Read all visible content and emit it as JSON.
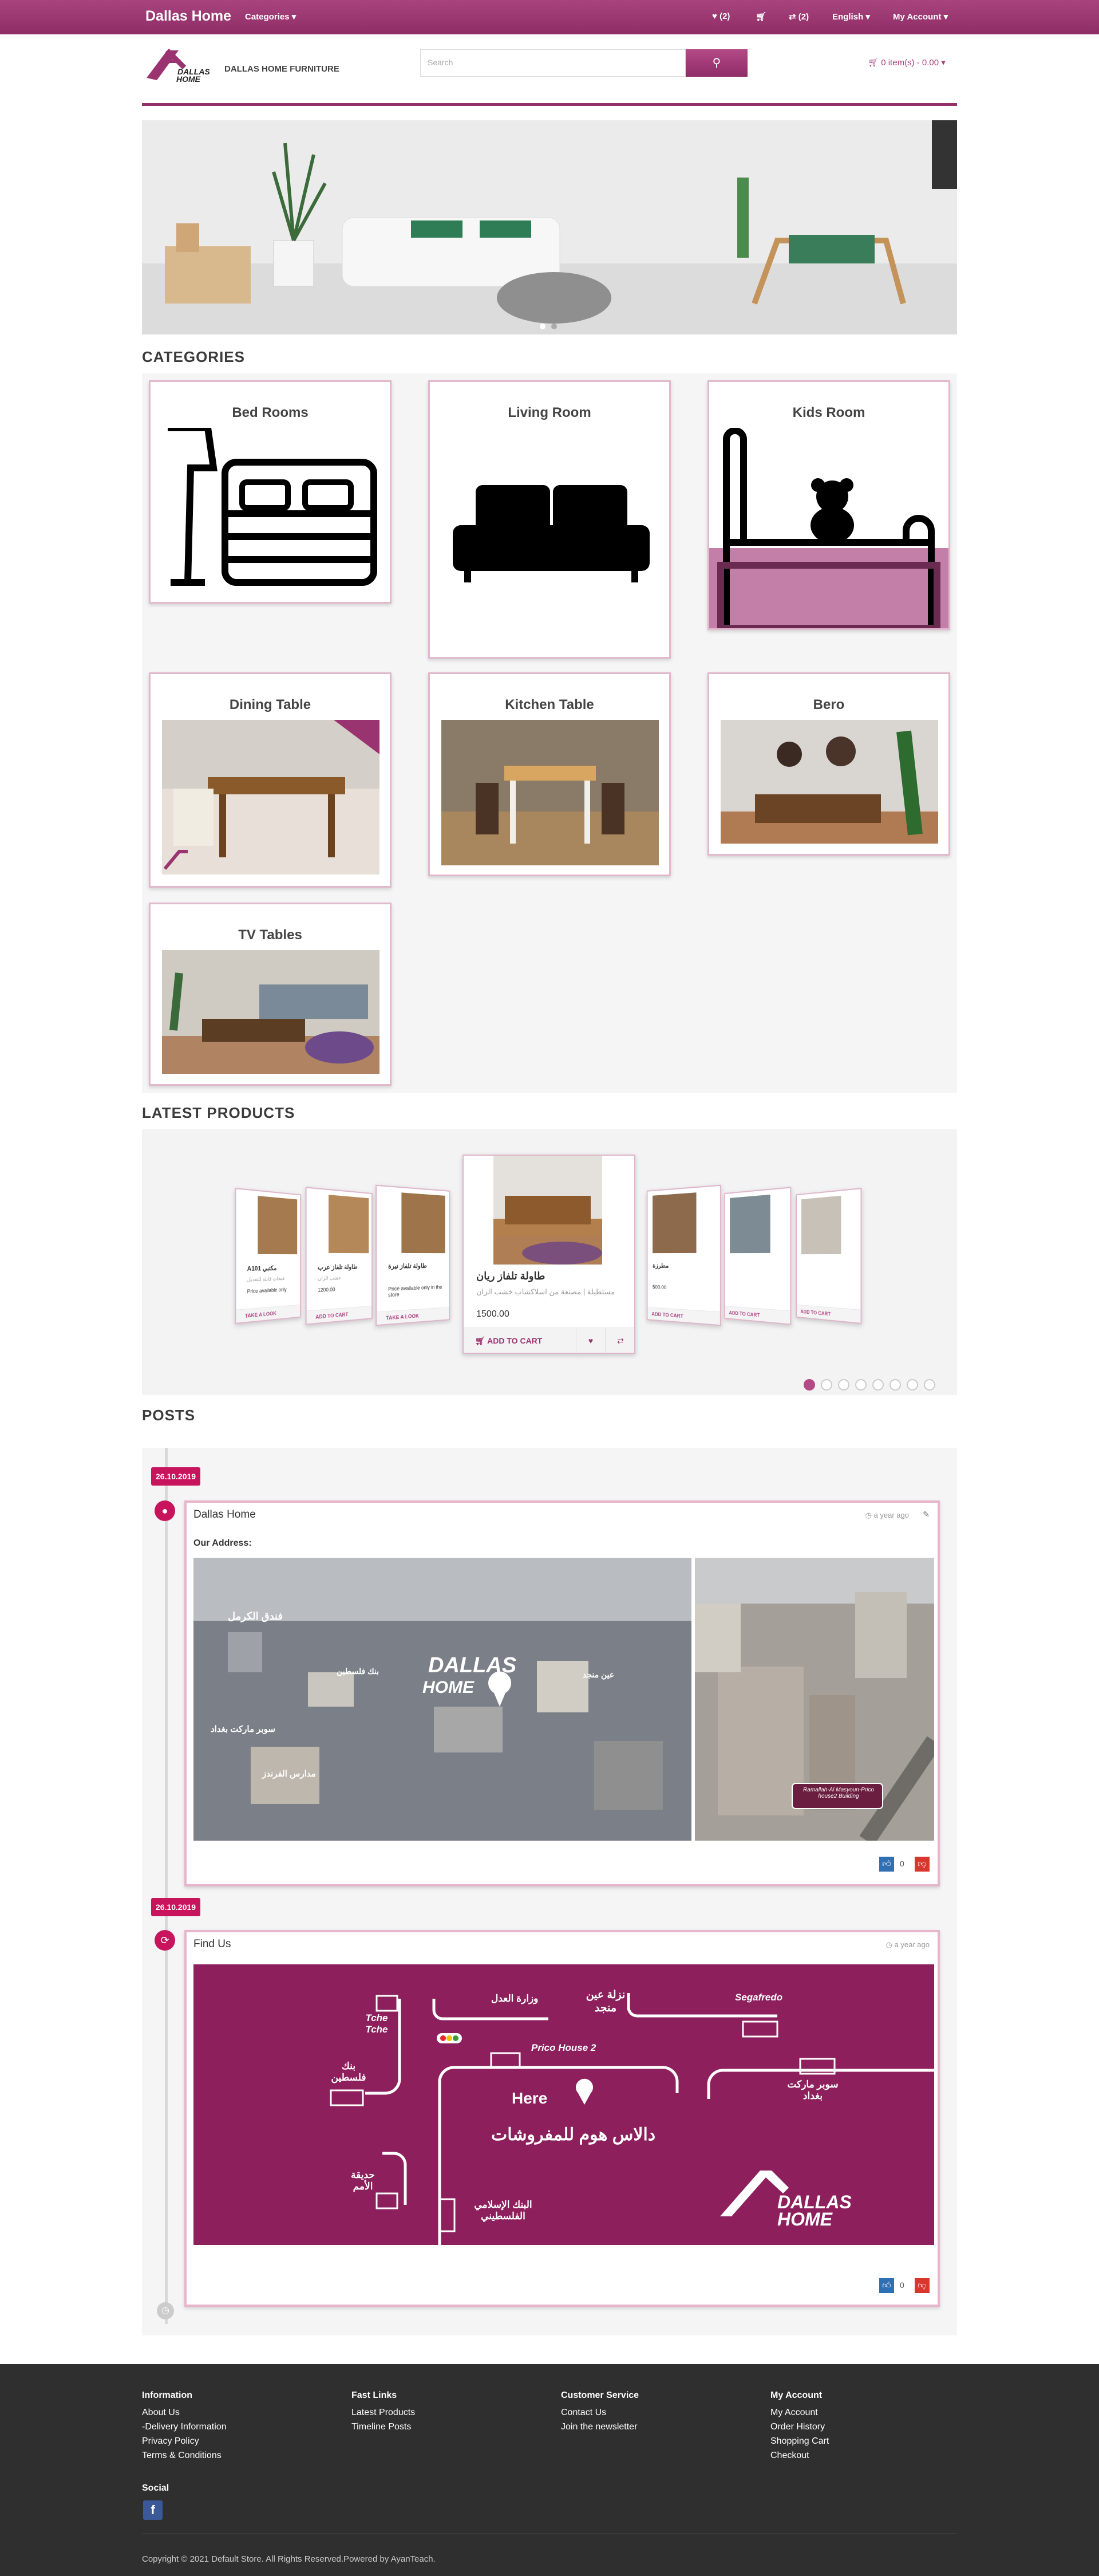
{
  "topbar": {
    "brand": "Dallas Home",
    "categories_label": "Categories",
    "wishlist_count": "(2)",
    "compare_count": "(2)",
    "language": "English",
    "account": "My Account"
  },
  "header": {
    "logo_text": "DALLAS HOME",
    "store_name": "DALLAS HOME FURNITURE",
    "search_placeholder": "Search",
    "cart_label": "0 item(s) - 0.00"
  },
  "categories": {
    "title": "CATEGORIES",
    "items": [
      {
        "label": "Bed Rooms"
      },
      {
        "label": "Living Room"
      },
      {
        "label": "Kids Room"
      },
      {
        "label": "Dining Table"
      },
      {
        "label": "Kitchen Table"
      },
      {
        "label": "Bero"
      },
      {
        "label": "TV Tables"
      }
    ]
  },
  "latest": {
    "title": "LATEST PRODUCTS",
    "featured": {
      "name": "طاولة تلفاز ريان",
      "desc": "مستطيلة | مصنعة من اسلاكشاب خشب الزان",
      "price": "1500.00",
      "add_to_cart": "ADD TO CART"
    },
    "side_cards": [
      {
        "name": "A101 مكتبي",
        "desc": "فتحات قابلة للتعديل",
        "price": "Price available only",
        "bar": "TAKE A LOOK"
      },
      {
        "name": "طاولة تلفاز عرب",
        "desc": "خشب الزان",
        "price": "1200.00",
        "bar": "ADD TO CART"
      },
      {
        "name": "طاولة تلفاز نيرة",
        "desc": "",
        "price": "Price available only in the store",
        "bar": "TAKE A LOOK"
      },
      {
        "name": "مطرزة",
        "desc": "",
        "price": "500.00",
        "bar": "ADD TO CART"
      },
      {
        "name": "",
        "desc": "",
        "price": "",
        "bar": "ADD TO CART"
      },
      {
        "name": "",
        "desc": "",
        "price": "",
        "bar": "ADD TO CART"
      }
    ],
    "dots": 8
  },
  "posts": {
    "title": "POSTS",
    "items": [
      {
        "date": "26.10.2019",
        "title": "Dallas Home",
        "ago": "a year ago",
        "subtitle": "Our Address:",
        "likes": "0",
        "map_labels": {
          "brand": "DALLAS HOME",
          "l1": "فندق الكرمل",
          "l2": "سوبر ماركت بغداد",
          "l3": "عين منجد",
          "l4": "بنك فلسطين",
          "l5": "مدارس الفرندز",
          "caption": "Ramallah-Al Masyoun-Prico house2 Building"
        }
      },
      {
        "date": "26.10.2019",
        "title": "Find Us",
        "ago": "a year ago",
        "likes": "0",
        "map_labels": {
          "tche": "Tche Tche",
          "justice": "وزارة العدل",
          "ein": "نزلة عين منجد",
          "segafredo": "Segafredo",
          "bank": "بنك فلسطين",
          "prico": "Prico House 2",
          "baghdad": "سوبر ماركت بغداد",
          "here": "Here",
          "slogan": "دالاس هوم للمفروشات",
          "garden": "حديقة الأمم",
          "islamic": "البنك الإسلامي الفلسطيني",
          "logo": "DALLAS HOME"
        }
      }
    ]
  },
  "footer": {
    "information": {
      "title": "Information",
      "links": [
        "About Us",
        "-Delivery Information",
        "Privacy Policy",
        "Terms & Conditions"
      ]
    },
    "fast_links": {
      "title": "Fast Links",
      "links": [
        "Latest Products",
        "Timeline Posts"
      ]
    },
    "customer_service": {
      "title": "Customer Service",
      "links": [
        "Contact Us",
        "Join the newsletter"
      ]
    },
    "my_account": {
      "title": "My Account",
      "links": [
        "My Account",
        "Order History",
        "Shopping Cart",
        "Checkout"
      ]
    },
    "social_title": "Social",
    "copyright": "Copyright © 2021 Default Store. All Rights Reserved.Powered by AyanTeach."
  },
  "colors": {
    "accent": "#9a3470",
    "badge": "#c8145c",
    "footer": "#2f2f2f"
  }
}
